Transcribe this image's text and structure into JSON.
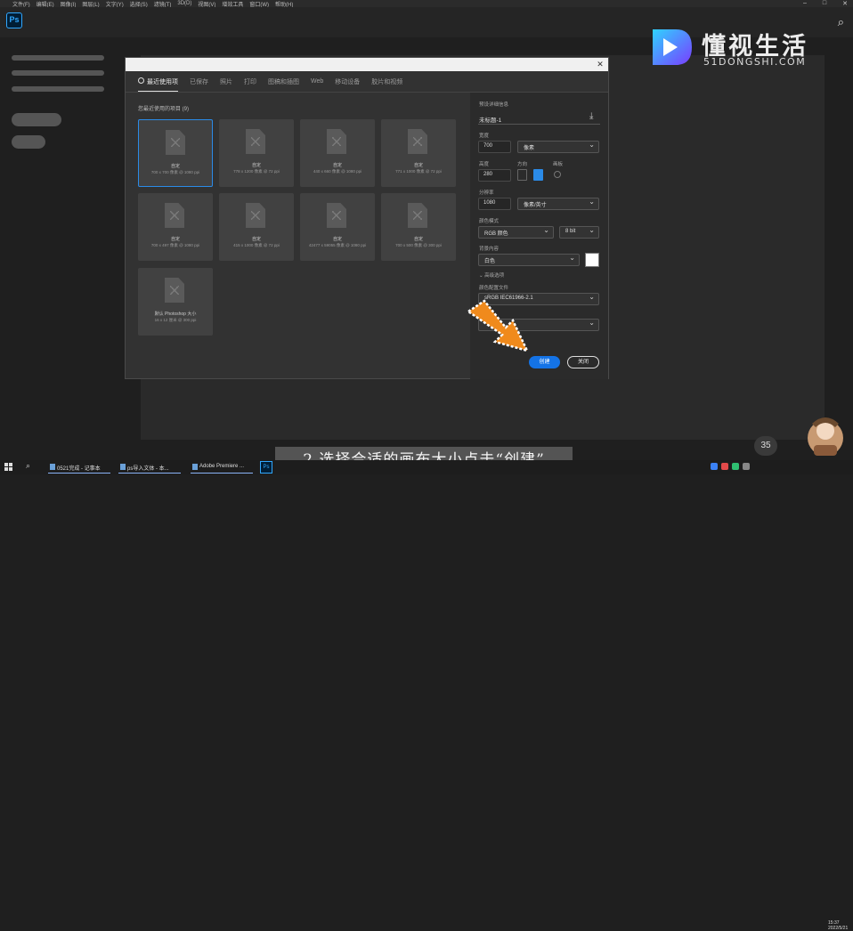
{
  "menubar": {
    "items": [
      "文件(F)",
      "编辑(E)",
      "图像(I)",
      "图层(L)",
      "文字(Y)",
      "选择(S)",
      "滤镜(T)",
      "3D(D)",
      "视图(V)",
      "增效工具",
      "窗口(W)",
      "帮助(H)"
    ],
    "window_controls": [
      "–",
      "□",
      "✕"
    ]
  },
  "appbar": {
    "logo": "Ps",
    "search_icon": "⌕"
  },
  "watermark": {
    "name": "懂视生活",
    "url": "51DONGSHI.COM"
  },
  "dialog": {
    "close_glyph": "✕",
    "tabs": [
      "最近使用项",
      "已保存",
      "照片",
      "打印",
      "图稿和插图",
      "Web",
      "移动设备",
      "胶片和视频"
    ],
    "recent_label": "您最近使用的项目 (9)",
    "presets": [
      {
        "name": "自定",
        "size": "700 x 700 像素 @ 1080 ppi"
      },
      {
        "name": "自定",
        "size": "778 x 1200 像素 @ 72 ppi"
      },
      {
        "name": "自定",
        "size": "440 x 660 像素 @ 1080 ppi"
      },
      {
        "name": "自定",
        "size": "771 x 1000 像素 @ 72 ppi"
      },
      {
        "name": "自定",
        "size": "700 x 497 像素 @ 1080 ppi"
      },
      {
        "name": "自定",
        "size": "415 x 1000 像素 @ 72 ppi"
      },
      {
        "name": "自定",
        "size": "42477 x 59055 像素 @ 1080 ppi"
      },
      {
        "name": "自定",
        "size": "700 x 500 像素 @ 300 ppi"
      },
      {
        "name": "默认 Photoshop 大小",
        "size": "16 x 12 厘米 @ 300 ppi"
      }
    ],
    "details": {
      "header": "预设详细信息",
      "doc_name": "未标题-1",
      "width_label": "宽度",
      "width_value": "700",
      "width_unit": "像素",
      "height_label": "高度",
      "height_value": "280",
      "orientation_label": "方向",
      "artboard_label": "画板",
      "resolution_label": "分辨率",
      "resolution_value": "1080",
      "resolution_unit": "像素/英寸",
      "color_mode_label": "颜色模式",
      "color_mode_value": "RGB 颜色",
      "bit_depth": "8 bit",
      "bg_label": "背景内容",
      "bg_value": "白色",
      "advanced_label": "高级选项",
      "profile_label": "颜色配置文件",
      "profile_value": "sRGB IEC61966-2.1"
    },
    "create_button": "创建",
    "close_button": "关闭"
  },
  "caption": "2.选择合适的画布大小点击“创建”",
  "taskbar": {
    "tasks": [
      "0521完成 - 记事本",
      "ps导入文体 - 本...",
      "Adobe Premiere ...",
      "Ps"
    ],
    "badge": "35",
    "clock_time": "15:37",
    "clock_date": "2022/5/21"
  },
  "colors": {
    "accent": "#1473e6",
    "arrow": "#f08a1c",
    "ps_blue": "#31a8ff"
  }
}
